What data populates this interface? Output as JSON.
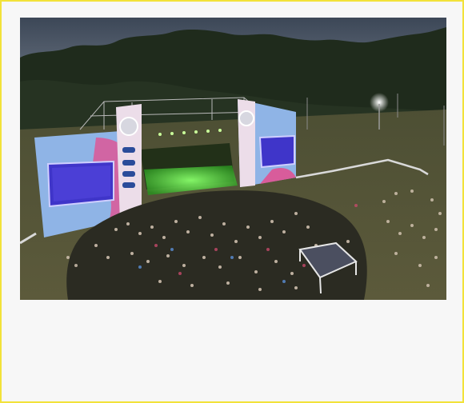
{
  "photo": {
    "description_hidden": "",
    "palette": {
      "sky": "#3c4757",
      "sky_light": "#5b6573",
      "trees": "#1f2b1c",
      "field": "#5a5a3a",
      "stage_green": "#49d13a",
      "screen_blue": "#3f35c9",
      "banner_blue": "#8fb4e6",
      "banner_pink": "#d85c9b",
      "frame_border": "#f2e23a"
    },
    "icons": {
      "stage": "stage-icon",
      "screen_left": "video-screen-icon",
      "screen_right": "video-screen-icon",
      "crowd": "crowd-icon",
      "floodlight": "light-icon"
    }
  }
}
